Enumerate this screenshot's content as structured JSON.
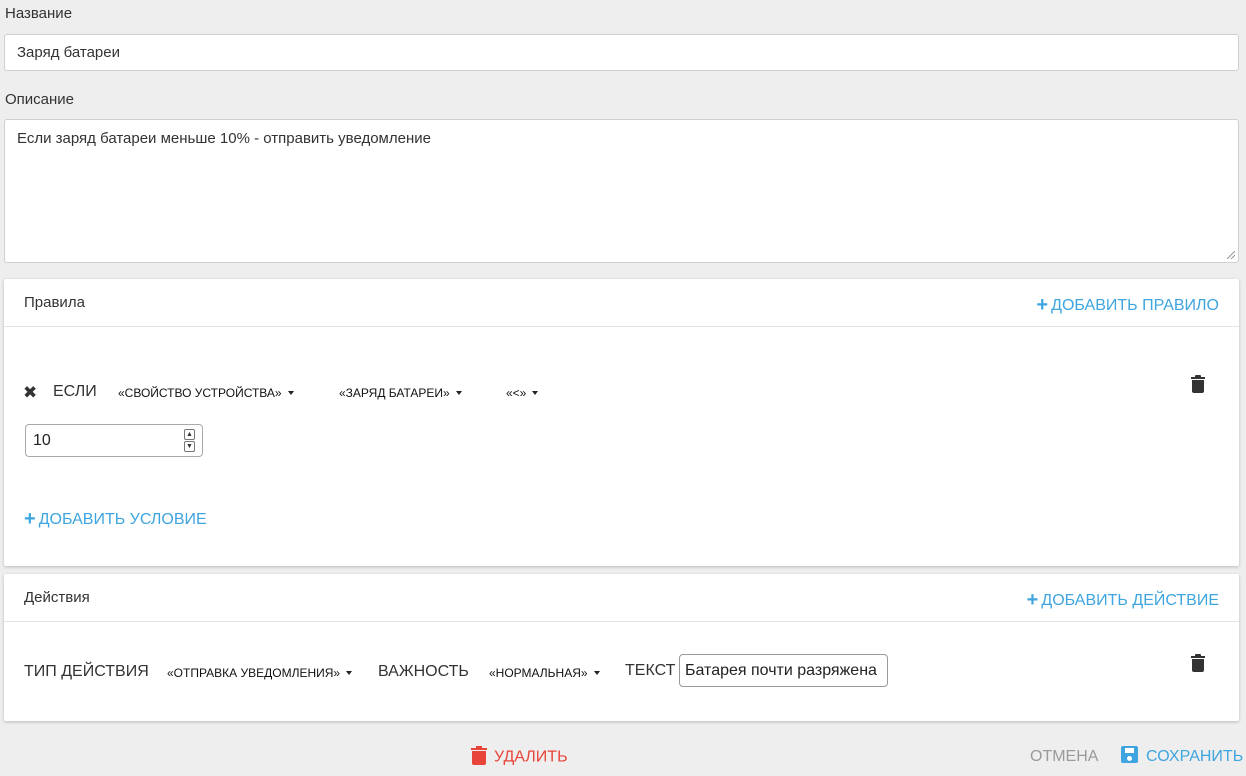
{
  "form": {
    "name_label": "Название",
    "name_value": "Заряд батареи",
    "description_label": "Описание",
    "description_value": "Если заряд батареи меньше 10% - отправить уведомление"
  },
  "rules": {
    "title": "Правила",
    "add_rule": "ДОБАВИТЬ ПРАВИЛО",
    "if_label": "ЕСЛИ",
    "condition": {
      "source": "«СВОЙСТВО УСТРОЙСТВА»",
      "property": "«ЗАРЯД БАТАРЕИ»",
      "operator": "«<»",
      "value": "10"
    },
    "add_condition": "ДОБАВИТЬ УСЛОВИЕ"
  },
  "actions": {
    "title": "Действия",
    "add_action": "ДОБАВИТЬ ДЕЙСТВИЕ",
    "action_type_label": "ТИП ДЕЙСТВИЯ",
    "action_type_value": "«ОТПРАВКА УВЕДОМЛЕНИЯ»",
    "importance_label": "ВАЖНОСТЬ",
    "importance_value": "«НОРМАЛЬНАЯ»",
    "text_label": "ТЕКСТ",
    "text_value": "Батарея почти разряжена"
  },
  "footer": {
    "delete": "УДАЛИТЬ",
    "cancel": "ОТМЕНА",
    "save": "СОХРАНИТЬ"
  },
  "colors": {
    "accent": "#3ea5e0",
    "danger": "#e8443a",
    "muted": "#9a9a9a",
    "background": "#eeeeee"
  },
  "icons": [
    "plus-icon",
    "close-icon",
    "trash-icon",
    "caret-down-icon",
    "floppy-disk-icon"
  ]
}
